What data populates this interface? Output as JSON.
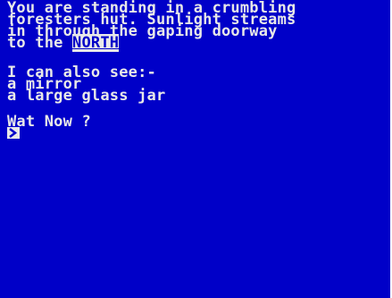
{
  "screen": {
    "colors": {
      "paper": "#0000c8",
      "ink": "#e8e8e8"
    },
    "description_lines": [
      "You are standing in a crumbling",
      "foresters hut. Sunlight streams",
      "in through the gaping doorway",
      "to the "
    ],
    "exit_highlight": "NORTH",
    "see_heading": "I can also see:-",
    "items": [
      "a mirror",
      "a large glass jar"
    ],
    "prompt": "Wat Now ?"
  }
}
